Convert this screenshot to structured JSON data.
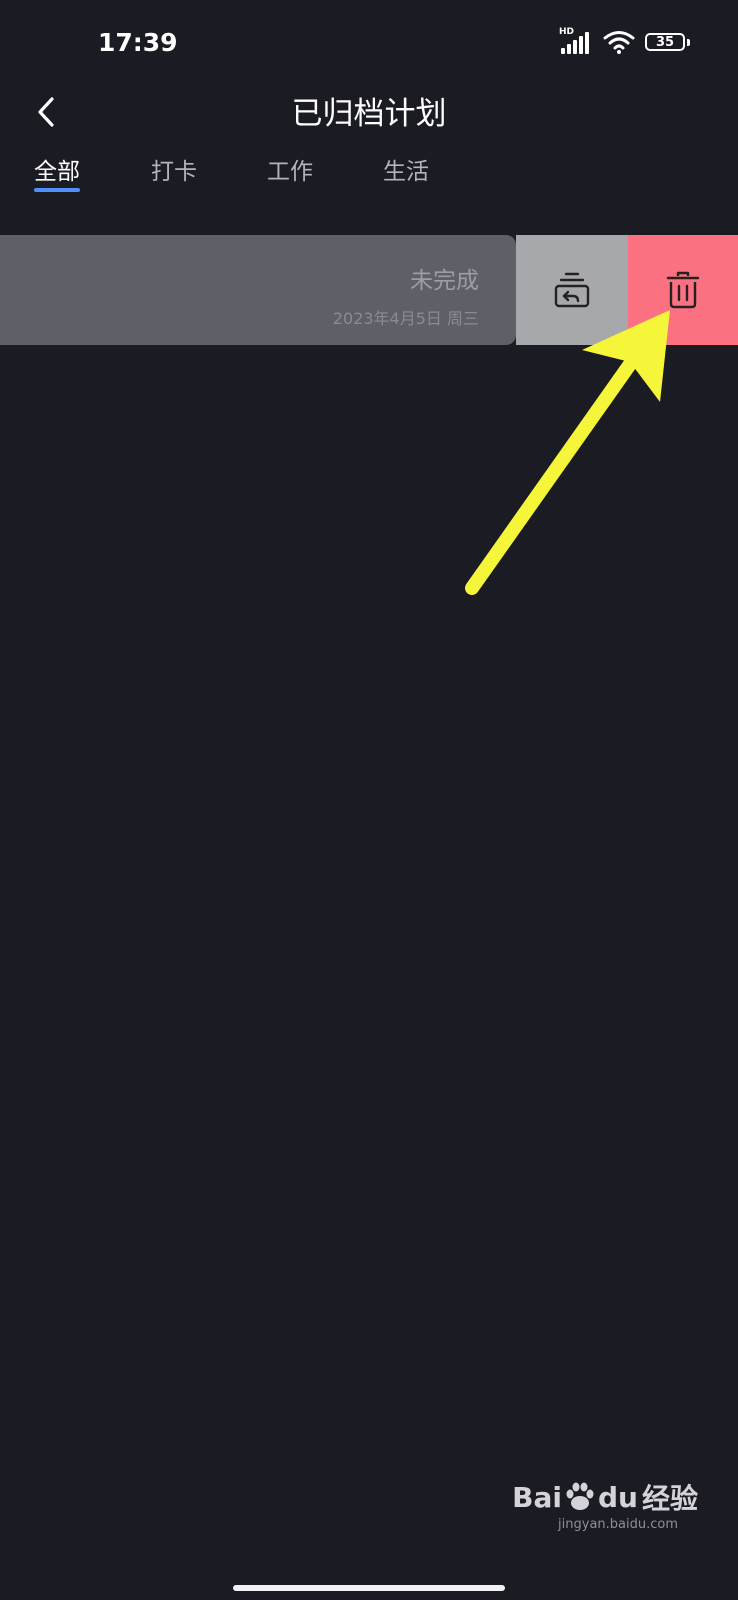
{
  "status_bar": {
    "time": "17:39",
    "network": "HD",
    "battery": "35",
    "icons": [
      "signal-icon",
      "wifi-icon",
      "battery-icon"
    ]
  },
  "header": {
    "back_icon": "chevron-left-icon",
    "title": "已归档计划"
  },
  "tabs": [
    {
      "label": "全部",
      "active": true
    },
    {
      "label": "打卡",
      "active": false
    },
    {
      "label": "工作",
      "active": false
    },
    {
      "label": "生活",
      "active": false
    }
  ],
  "archived_item": {
    "status": "未完成",
    "date": "2023年4月5日 周三",
    "actions": {
      "restore_icon": "unarchive-icon",
      "delete_icon": "trash-icon"
    }
  },
  "watermark": {
    "brand_a": "Bai",
    "brand_b": "du",
    "brand_c": "经验",
    "url": "jingyan.baidu.com"
  },
  "colors": {
    "background": "#1b1b24",
    "tab_accent": "#4f8ff7",
    "card": "#5f6067",
    "restore_action": "#a7a8ab",
    "delete_action": "#fc7181",
    "annotation_arrow": "#f5f53a"
  }
}
